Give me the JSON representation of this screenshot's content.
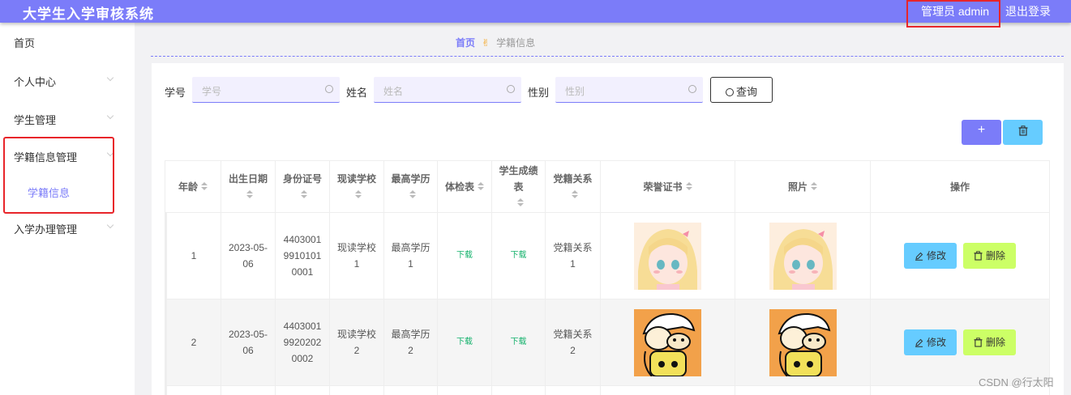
{
  "header": {
    "title": "大学生入学审核系统",
    "admin": "管理员 admin",
    "logout": "退出登录"
  },
  "sidebar": {
    "items": [
      {
        "label": "首页"
      },
      {
        "label": "个人中心"
      },
      {
        "label": "学生管理"
      },
      {
        "label": "学籍信息管理"
      },
      {
        "label": "入学办理管理"
      }
    ],
    "sub_item": "学籍信息"
  },
  "breadcrumb": {
    "home": "首页",
    "separator": "✌",
    "current": "学籍信息"
  },
  "search": {
    "fields": [
      {
        "label": "学号",
        "placeholder": "学号"
      },
      {
        "label": "姓名",
        "placeholder": "姓名"
      },
      {
        "label": "性别",
        "placeholder": "性别"
      }
    ],
    "query_label": "查询"
  },
  "toolbar": {
    "add_label": "+",
    "delete_icon": "trash-icon"
  },
  "table": {
    "headers": [
      "年龄",
      "出生日期",
      "身份证号",
      "现读学校",
      "最高学历",
      "体检表",
      "学生成绩表",
      "党籍关系",
      "荣誉证书",
      "照片",
      "操作"
    ],
    "rows": [
      {
        "age": "1",
        "birth": "2023-05-06",
        "id": "440300199101010001",
        "school": "现读学校1",
        "edu": "最高学历1",
        "health": "下载",
        "grades": "下载",
        "party": "党籍关系1"
      },
      {
        "age": "2",
        "birth": "2023-05-06",
        "id": "440300199202020002",
        "school": "现读学校2",
        "edu": "最高学历2",
        "health": "下载",
        "grades": "下载",
        "party": "党籍关系2"
      }
    ],
    "edit_label": "修改",
    "delete_label": "删除"
  },
  "watermark": "CSDN @行太阳",
  "colors": {
    "accent": "#7b7cf9",
    "edit": "#66ccff",
    "delete": "#ccff66",
    "highlight": "#e8252a"
  }
}
